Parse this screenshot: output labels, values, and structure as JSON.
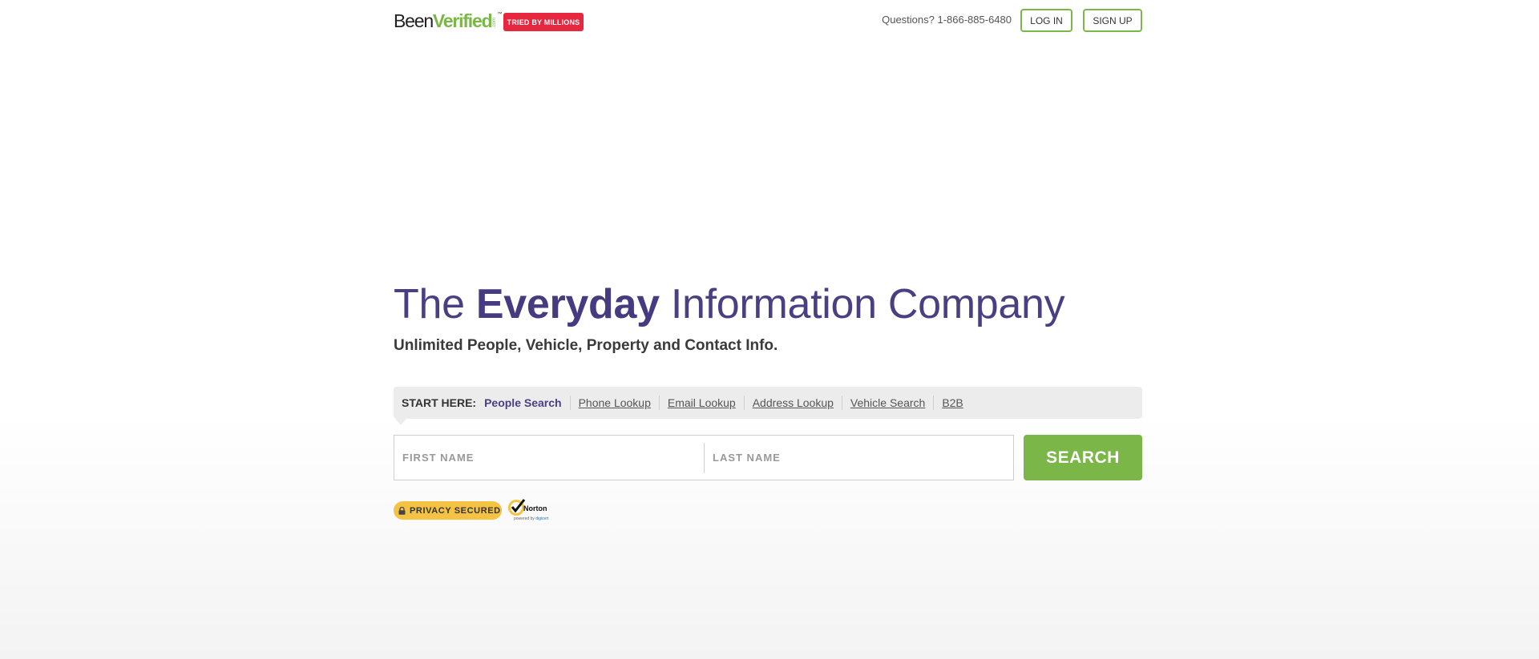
{
  "header": {
    "logo": {
      "part1": "Been",
      "part2": "Verified",
      "com": ".com",
      "tm": "™"
    },
    "badge": "TRIED BY MILLIONS",
    "questions": "Questions? 1-866-885-6480",
    "login_label": "LOG IN",
    "signup_label": "SIGN UP"
  },
  "hero": {
    "title_pre": "The ",
    "title_strong": "Everyday",
    "title_post": " Information Company",
    "subtitle": "Unlimited People, Vehicle, Property and Contact Info."
  },
  "nav": {
    "start_label": "START HERE:",
    "items": [
      {
        "label": "People Search",
        "active": true
      },
      {
        "label": "Phone Lookup"
      },
      {
        "label": "Email Lookup"
      },
      {
        "label": "Address Lookup"
      },
      {
        "label": "Vehicle Search"
      },
      {
        "label": "B2B"
      }
    ]
  },
  "search": {
    "first_placeholder": "FIRST NAME",
    "last_placeholder": "LAST NAME",
    "button_label": "SEARCH"
  },
  "trust": {
    "privacy_label": "PRIVACY SECURED",
    "norton_label": "Norton",
    "norton_sub_pre": "powered by ",
    "norton_sub_brand": "digicert"
  },
  "colors": {
    "brand_green": "#7ab648",
    "brand_purple": "#4a3f82",
    "badge_red": "#e5273f",
    "privacy_yellow": "#f5c343"
  }
}
